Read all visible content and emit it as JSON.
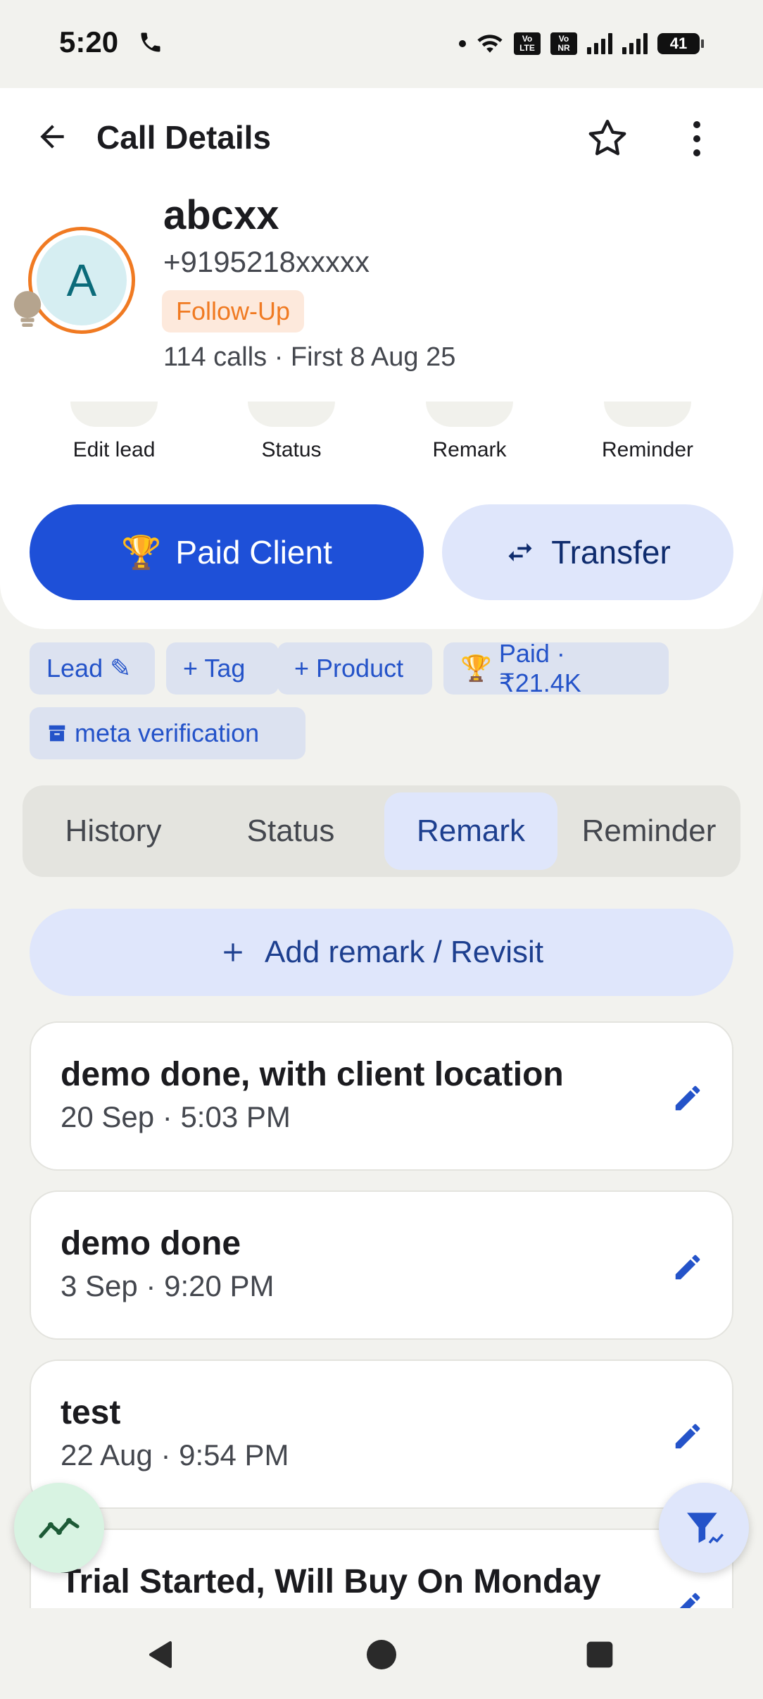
{
  "status_bar": {
    "time": "5:20",
    "volte1": "Vo LTE",
    "volte2": "Vo NR",
    "battery": "41"
  },
  "header": {
    "title": "Call Details"
  },
  "contact": {
    "initial": "A",
    "name": "abcxx",
    "phone": "+9195218xxxxx",
    "badge": "Follow-Up",
    "calls_info": "114 calls · First 8 Aug 25"
  },
  "quick_actions": [
    {
      "label": "Edit lead"
    },
    {
      "label": "Status"
    },
    {
      "label": "Remark"
    },
    {
      "label": "Reminder"
    }
  ],
  "primary_buttons": {
    "paid_emoji": "🏆",
    "paid_label": "Paid Client",
    "transfer_label": "Transfer"
  },
  "chips": {
    "lead": "Lead ✎",
    "tag": "+ Tag",
    "product": "+ Product",
    "paid_emoji": "🏆",
    "paid": "Paid · ₹21.4K",
    "meta": "meta verification"
  },
  "tabs": [
    {
      "label": "History"
    },
    {
      "label": "Status"
    },
    {
      "label": "Remark",
      "active": true
    },
    {
      "label": "Reminder"
    }
  ],
  "add_remark": {
    "label": "Add remark / Revisit"
  },
  "remarks": [
    {
      "title": "demo done, with client location",
      "time": "20 Sep · 5:03 PM"
    },
    {
      "title": "demo done",
      "time": "3 Sep · 9:20 PM"
    },
    {
      "title": "test",
      "time": "22 Aug · 9:54 PM"
    },
    {
      "title": "Trial Started, Will Buy On Monday",
      "time": ""
    }
  ],
  "colors": {
    "accent": "#1e50d8",
    "follow_up": "#f07a22",
    "chip_text": "#2453c9"
  }
}
